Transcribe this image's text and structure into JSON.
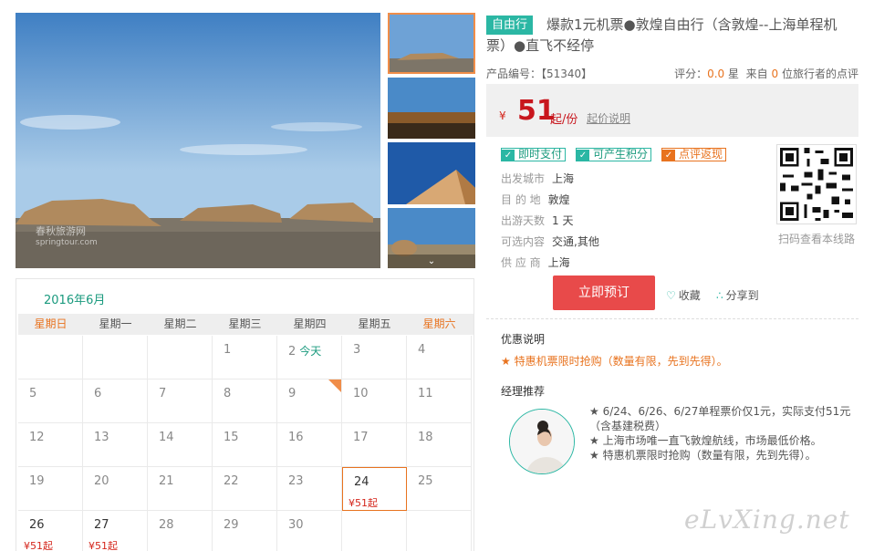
{
  "product": {
    "badge": "自由行",
    "title_line1": "爆款1元机票●敦煌自由行（含敦煌--上海单程机",
    "title_line2": "票）●直飞不经停",
    "code_label": "产品编号：【51340】",
    "rating_label": "评分：",
    "rating_value": "0.0",
    "rating_unit": "星",
    "reviews_prefix": "来自",
    "reviews_count": "0",
    "reviews_suffix": "位旅行者的点评"
  },
  "price": {
    "currency": "¥",
    "amount": "51",
    "unit": "起/份",
    "explain_link": "起价说明"
  },
  "tags": [
    "即时支付",
    "可产生积分",
    "点评返现"
  ],
  "details": [
    {
      "label": "出发城市",
      "value": "上海"
    },
    {
      "label": "目 的 地",
      "value": "敦煌"
    },
    {
      "label": "出游天数",
      "value": "1 天"
    },
    {
      "label": "可选内容",
      "value": "交通,其他"
    },
    {
      "label": "供 应 商",
      "value": "上海"
    }
  ],
  "qr": {
    "caption": "扫码查看本线路"
  },
  "actions": {
    "book": "立即预订",
    "favorite": "收藏",
    "share": "分享到"
  },
  "promo": {
    "heading": "优惠说明",
    "text": "★ 特惠机票限时抢购（数量有限，先到先得）。"
  },
  "manager": {
    "heading": "经理推荐",
    "items": [
      "★ 6/24、6/26、6/27单程票价仅1元，实际支付51元",
      "（含基建税费）",
      "★ 上海市场唯一直飞敦煌航线，市场最低价格。",
      "★ 特惠机票限时抢购（数量有限，先到先得）。"
    ]
  },
  "gallery": {
    "photo_watermark": "春秋旅游网",
    "photo_watermark_url": "springtour.com",
    "thumb_count": 4,
    "active_thumb": 1
  },
  "calendar": {
    "month": "2016年6月",
    "weekdays": [
      "星期日",
      "星期一",
      "星期二",
      "星期三",
      "星期四",
      "星期五",
      "星期六"
    ],
    "today_label": "今天",
    "weeks": [
      [
        null,
        null,
        null,
        {
          "d": "1"
        },
        {
          "d": "2",
          "today": true
        },
        {
          "d": "3"
        },
        {
          "d": "4"
        }
      ],
      [
        {
          "d": "5"
        },
        {
          "d": "6"
        },
        {
          "d": "7"
        },
        {
          "d": "8"
        },
        {
          "d": "9",
          "tag": true
        },
        {
          "d": "10"
        },
        {
          "d": "11"
        }
      ],
      [
        {
          "d": "12"
        },
        {
          "d": "13"
        },
        {
          "d": "14"
        },
        {
          "d": "15"
        },
        {
          "d": "16"
        },
        {
          "d": "17"
        },
        {
          "d": "18"
        }
      ],
      [
        {
          "d": "19"
        },
        {
          "d": "20"
        },
        {
          "d": "21"
        },
        {
          "d": "22"
        },
        {
          "d": "23"
        },
        {
          "d": "24",
          "price": "¥51起",
          "selected": true
        },
        {
          "d": "25"
        }
      ],
      [
        {
          "d": "26",
          "price": "¥51起"
        },
        {
          "d": "27",
          "price": "¥51起"
        },
        {
          "d": "28"
        },
        {
          "d": "29"
        },
        {
          "d": "30"
        },
        null,
        null
      ]
    ]
  },
  "watermark": "eLvXing.net",
  "colors": {
    "accent": "#2bb7a4",
    "price": "#c8161d",
    "orange": "#e8731f",
    "book": "#e84a4a"
  }
}
